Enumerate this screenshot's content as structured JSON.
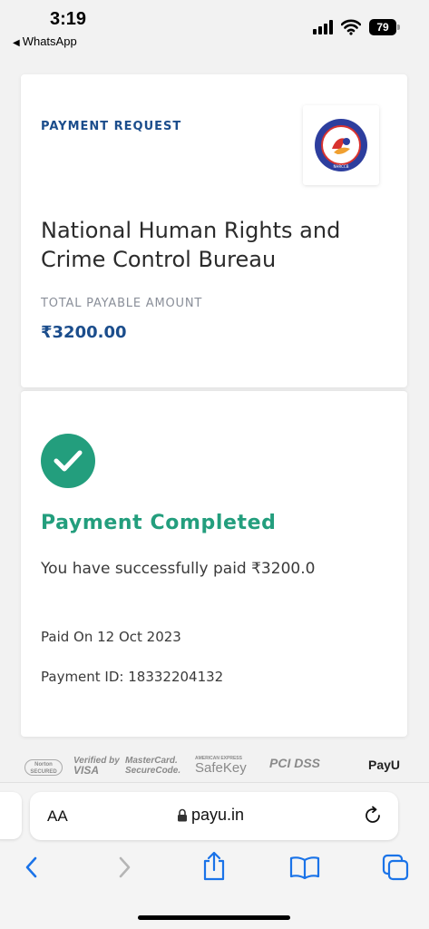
{
  "status_bar": {
    "time": "3:19",
    "back_app": "WhatsApp",
    "battery": "79"
  },
  "payment_card": {
    "heading": "PAYMENT REQUEST",
    "merchant_name": "National Human Rights and Crime Control Bureau",
    "total_label": "TOTAL PAYABLE AMOUNT",
    "total_amount": "₹3200.00",
    "logo_text": "NHRCCB"
  },
  "status_card": {
    "title": "Payment Completed",
    "message": "You have successfully paid ₹3200.0",
    "paid_on": "Paid On 12 Oct 2023",
    "payment_id": "Payment ID: 18332204132",
    "success_color": "#239e7d"
  },
  "trust_badges": {
    "norton": "Norton SECURED",
    "visa_line1": "Verified by",
    "visa_line2": "VISA",
    "mc_line1": "MasterCard.",
    "mc_line2": "SecureCode.",
    "amex_small": "AMERICAN EXPRESS",
    "amex_big": "SafeKey",
    "pci": "PCI DSS",
    "payu": "PayU"
  },
  "browser": {
    "aa_label": "AA",
    "url": "payu.in"
  },
  "colors": {
    "accent_blue": "#1b4d8c",
    "ios_blue": "#1a73e8"
  }
}
